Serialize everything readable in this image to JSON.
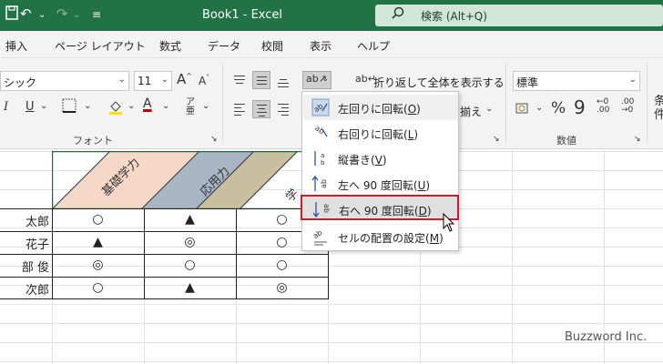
{
  "titlebar": {
    "title": "Book1  -  Excel",
    "search_placeholder": "検索 (Alt+Q)"
  },
  "menu_tabs": [
    "挿入",
    "ページ レイアウト",
    "数式",
    "データ",
    "校閲",
    "表示",
    "ヘルプ"
  ],
  "ribbon": {
    "font_name": "シック",
    "font_size": "11",
    "wrap_text_label": "折り返して全体を表示する",
    "merge_label": "揃え",
    "number_format": "標準",
    "font_group_label": "フォント",
    "number_group_label": "数値"
  },
  "header_cells": [
    "基礎学力",
    "応用力",
    "学"
  ],
  "rows": [
    {
      "name": "太郎",
      "marks": [
        "○",
        "▲",
        "○"
      ]
    },
    {
      "name": "花子",
      "marks": [
        "▲",
        "◎",
        "○"
      ]
    },
    {
      "name": "部 俊",
      "marks": [
        "◎",
        "○",
        "○"
      ]
    },
    {
      "name": "次郎",
      "marks": [
        "○",
        "▲",
        "◎"
      ]
    }
  ],
  "orientation_menu": {
    "items": [
      {
        "label": "左回りに回転",
        "key": "O"
      },
      {
        "label": "右回りに回転",
        "key": "L"
      },
      {
        "label": "縦書き",
        "key": "V"
      },
      {
        "label": "左へ 90 度回転",
        "key": "U"
      },
      {
        "label": "右へ 90 度回転",
        "key": "D"
      },
      {
        "label": "セルの配置の設定",
        "key": "M"
      }
    ],
    "highlighted_index": 4
  },
  "watermark": "Buzzword Inc.",
  "colors": {
    "excel_green": "#217346",
    "highlight_border": "#c41e2c",
    "header_fill_1": "#f6d8c8",
    "header_fill_2": "#a9b5c4",
    "header_fill_3": "#c9bfa0"
  }
}
